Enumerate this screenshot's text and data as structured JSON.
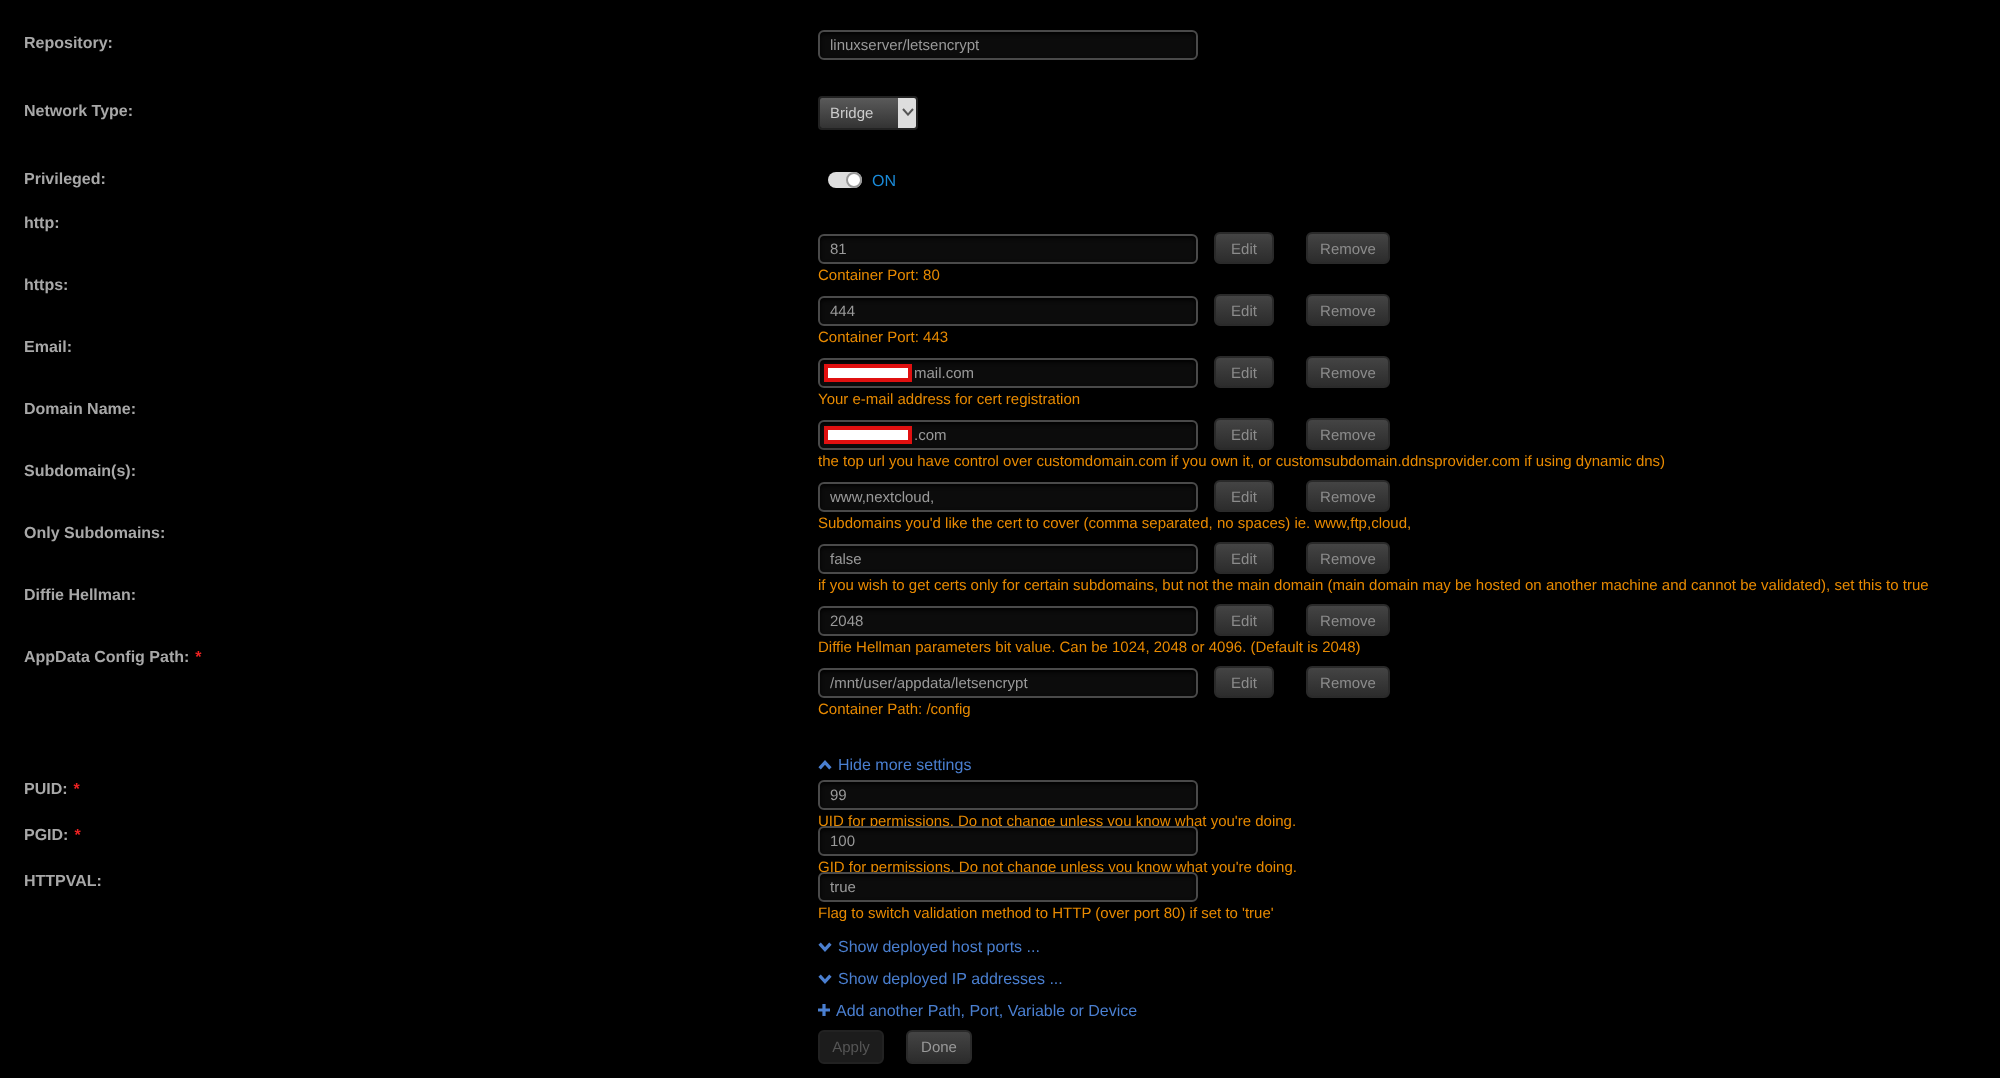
{
  "settings": [
    {
      "kind": "text",
      "label": "Repository:",
      "value": "linuxserver/letsencrypt"
    },
    {
      "kind": "select",
      "label": "Network Type:",
      "value": "Bridge"
    },
    {
      "kind": "toggle",
      "label": "Privileged:",
      "on": true,
      "state_text": "ON"
    }
  ],
  "config": [
    {
      "label": "http:",
      "value": "81",
      "redacted": false,
      "actions": [
        "Edit",
        "Remove"
      ],
      "note": "Container Port: 80"
    },
    {
      "label": "https:",
      "value": "444",
      "redacted": false,
      "actions": [
        "Edit",
        "Remove"
      ],
      "note": "Container Port: 443"
    },
    {
      "label": "Email:",
      "value": "mail.com",
      "redacted": true,
      "actions": [
        "Edit",
        "Remove"
      ],
      "note": "Your e-mail address for cert registration"
    },
    {
      "label": "Domain Name:",
      "value": ".com",
      "redacted": true,
      "actions": [
        "Edit",
        "Remove"
      ],
      "note": "the top url you have control over customdomain.com if you own it, or customsubdomain.ddnsprovider.com if using dynamic dns)"
    },
    {
      "label": "Subdomain(s):",
      "value": "www,nextcloud,",
      "redacted": false,
      "actions": [
        "Edit",
        "Remove"
      ],
      "note": "Subdomains you'd like the cert to cover (comma separated, no spaces) ie. www,ftp,cloud,"
    },
    {
      "label": "Only Subdomains:",
      "value": "false",
      "redacted": false,
      "actions": [
        "Edit",
        "Remove"
      ],
      "note": "if you wish to get certs only for certain subdomains, but not the main domain (main domain may be hosted on another machine and cannot be validated), set this to true"
    },
    {
      "label": "Diffie Hellman:",
      "value": "2048",
      "redacted": false,
      "actions": [
        "Edit",
        "Remove"
      ],
      "note": "Diffie Hellman parameters bit value. Can be 1024, 2048 or 4096. (Default is 2048)"
    },
    {
      "label": "AppData Config Path:",
      "required_mark": "*",
      "value": "/mnt/user/appdata/letsencrypt",
      "redacted": false,
      "actions": [
        "Edit",
        "Remove"
      ],
      "note": "Container Path: /config"
    }
  ],
  "more_settings": {
    "text": "Hide more settings",
    "expanded": true
  },
  "advanced": [
    {
      "label": "PUID:",
      "required_mark": "*",
      "value": "99",
      "note": "UID for permissions. Do not change unless you know what you're doing."
    },
    {
      "label": "PGID:",
      "required_mark": "*",
      "value": "100",
      "note": "GID for permissions. Do not change unless you know what you're doing."
    },
    {
      "label": "HTTPVAL:",
      "value": "true",
      "note": "Flag to switch validation method to HTTP (over port 80) if set to 'true'"
    }
  ],
  "links": [
    {
      "kind": "expand",
      "text": "Show deployed host ports ..."
    },
    {
      "kind": "expand",
      "text": "Show deployed IP addresses ..."
    },
    {
      "kind": "add",
      "text": "Add another Path, Port, Variable or Device"
    }
  ],
  "buttons": [
    {
      "label": "Apply",
      "disabled": true
    },
    {
      "label": "Done",
      "disabled": false
    }
  ]
}
